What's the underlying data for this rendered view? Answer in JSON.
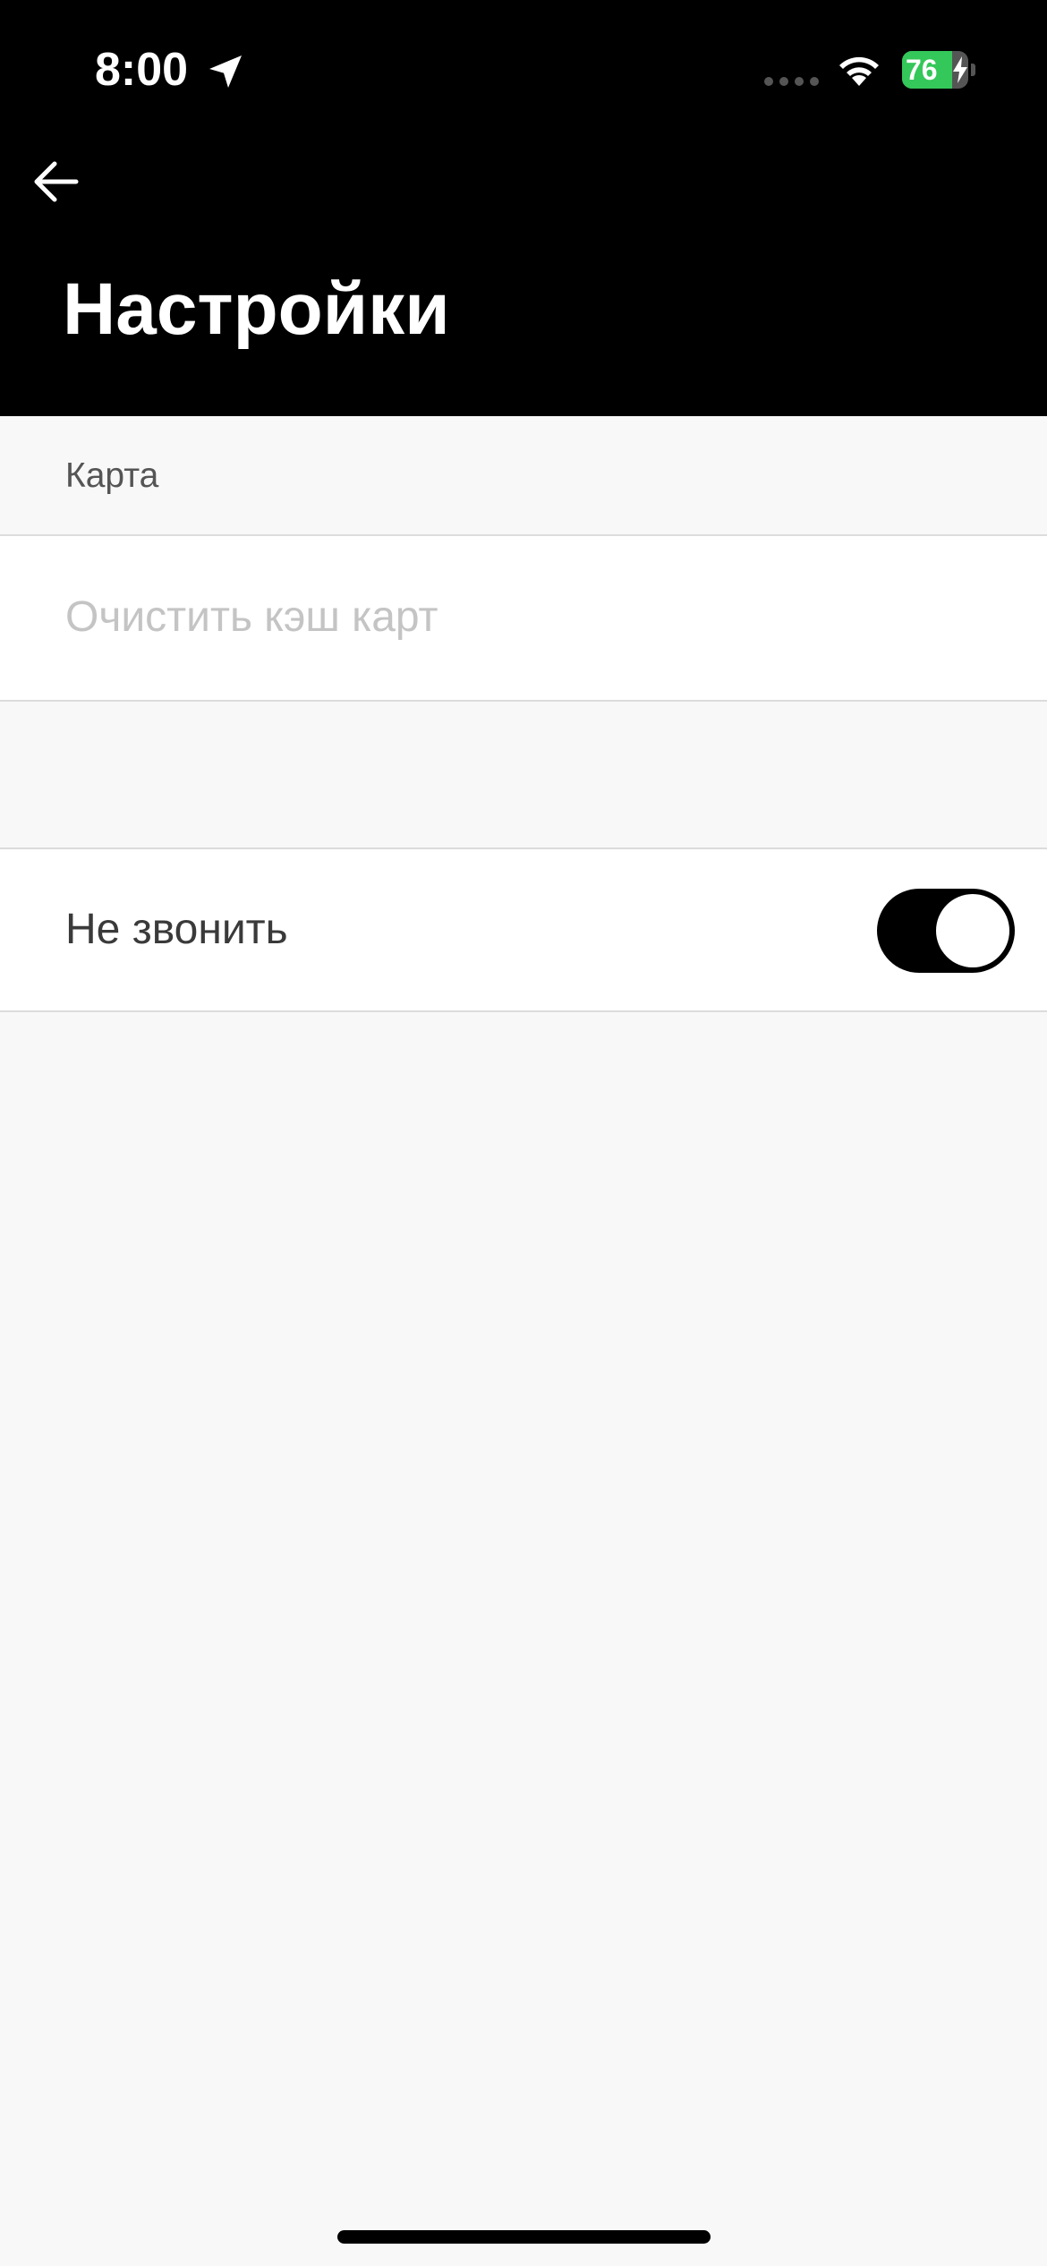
{
  "status_bar": {
    "time": "8:00",
    "battery_level": "76",
    "battery_fraction": 0.76,
    "battery_charging": true,
    "icons": [
      "location-arrow-icon",
      "cellular-signal-icon",
      "wifi-icon",
      "battery-icon",
      "charging-bolt-icon"
    ]
  },
  "header": {
    "back_icon": "arrow-left-icon",
    "title": "Настройки"
  },
  "sections": {
    "map": {
      "label": "Карта",
      "clear_cache_label": "Очистить кэш карт"
    },
    "calls": {
      "do_not_call_label": "Не звонить",
      "do_not_call_enabled": true
    }
  },
  "colors": {
    "header_background": "#000000",
    "page_background": "#f8f8f8",
    "row_background": "#ffffff",
    "toggle_on": "#000000",
    "battery_fill": "#34c759",
    "disabled_text": "#c4c4c4"
  }
}
